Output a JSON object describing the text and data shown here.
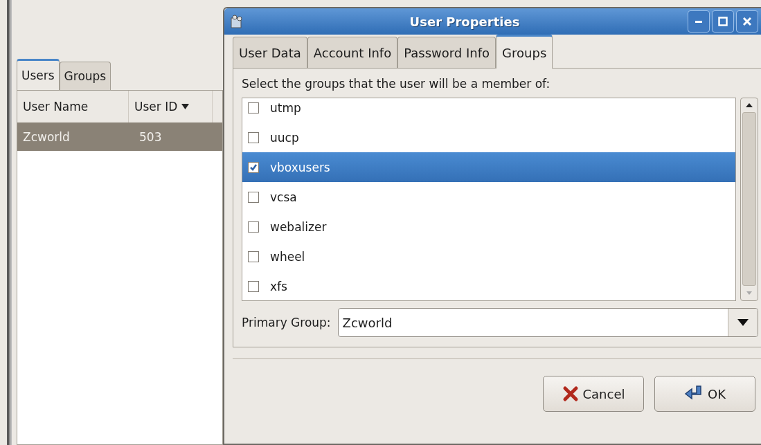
{
  "main_window": {
    "tabs": [
      {
        "label": "Users",
        "selected": true
      },
      {
        "label": "Groups",
        "selected": false
      }
    ],
    "columns": [
      {
        "label": "User Name",
        "sorted": false
      },
      {
        "label": "User ID",
        "sorted": true
      }
    ],
    "rows": [
      {
        "cells": [
          "Zcworld",
          "503"
        ],
        "selected": true
      }
    ]
  },
  "dialog": {
    "title": "User Properties",
    "tabs": [
      {
        "label": "User Data",
        "selected": false
      },
      {
        "label": "Account Info",
        "selected": false
      },
      {
        "label": "Password Info",
        "selected": false
      },
      {
        "label": "Groups",
        "selected": true
      }
    ],
    "instruction": "Select the groups that the user will be a member of:",
    "groups": [
      {
        "name": "utmp",
        "checked": false,
        "selected": false
      },
      {
        "name": "uucp",
        "checked": false,
        "selected": false
      },
      {
        "name": "vboxusers",
        "checked": true,
        "selected": true
      },
      {
        "name": "vcsa",
        "checked": false,
        "selected": false
      },
      {
        "name": "webalizer",
        "checked": false,
        "selected": false
      },
      {
        "name": "wheel",
        "checked": false,
        "selected": false
      },
      {
        "name": "xfs",
        "checked": false,
        "selected": false
      }
    ],
    "primary_group": {
      "label": "Primary Group:",
      "value": "Zcworld"
    },
    "buttons": [
      {
        "label": "Cancel",
        "kind": "cancel"
      },
      {
        "label": "OK",
        "kind": "ok"
      }
    ]
  }
}
